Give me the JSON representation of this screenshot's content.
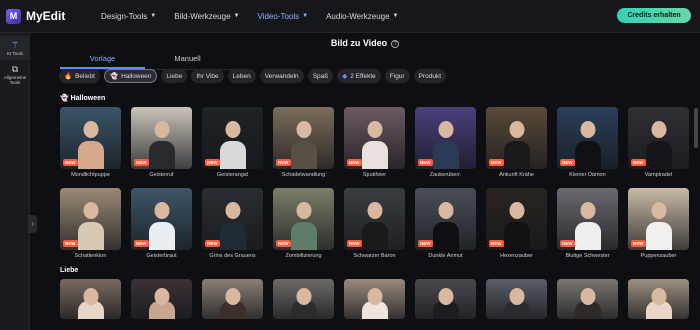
{
  "app": {
    "logo_letter": "M",
    "name": "MyEdit"
  },
  "nav": [
    {
      "label": "Design-Tools",
      "active": false
    },
    {
      "label": "Bild-Werkzeuge",
      "active": false
    },
    {
      "label": "Video-Tools",
      "active": true
    },
    {
      "label": "Audio-Werkzeuge",
      "active": false
    }
  ],
  "cta_label": "Credits erhalten",
  "sidebar": [
    {
      "label": "KI Tools",
      "icon": "magic-wand-icon",
      "active": true
    },
    {
      "label": "Allgemeine Tools",
      "icon": "layers-icon",
      "active": false
    }
  ],
  "page_title": "Bild zu Video",
  "tabs": [
    {
      "label": "Vorlage",
      "active": true
    },
    {
      "label": "Manuell",
      "active": false
    }
  ],
  "chips": [
    {
      "label": "Beliebt",
      "icon": "fire-icon",
      "active": false
    },
    {
      "label": "Halloween",
      "icon": "ghost-icon",
      "active": true
    },
    {
      "label": "Liebe",
      "active": false
    },
    {
      "label": "Ihr Vibe",
      "active": false
    },
    {
      "label": "Leben",
      "active": false
    },
    {
      "label": "Verwandeln",
      "active": false
    },
    {
      "label": "Spaß",
      "active": false
    },
    {
      "label": "2 Effekte",
      "icon": "diamond-icon",
      "active": false
    },
    {
      "label": "Figur",
      "active": false
    },
    {
      "label": "Produkt",
      "active": false
    }
  ],
  "sections": {
    "halloween": {
      "title": "Halloween",
      "icon": "ghost-icon"
    },
    "love": {
      "title": "Liebe"
    }
  },
  "new_badge": "NEW",
  "halloween_row1": [
    {
      "caption": "Mondlichtpuppe",
      "new": true,
      "bg": "#3a5668",
      "fig": "#d7a98c"
    },
    {
      "caption": "Geisterruf",
      "new": true,
      "bg": "#c9c3b9",
      "fig": "#2a2a2e"
    },
    {
      "caption": "Geisterangst",
      "new": true,
      "bg": "#1e2428",
      "fig": "#d9d9d9"
    },
    {
      "caption": "Schädelwandlung",
      "new": true,
      "bg": "#7b6d5a",
      "fig": "#5a4f45"
    },
    {
      "caption": "Spukfeier",
      "new": true,
      "bg": "#6b5a63",
      "fig": "#e8e1dd"
    },
    {
      "caption": "Zauberüberr.",
      "new": true,
      "bg": "#4b3f7d",
      "fig": "#2b3a55"
    },
    {
      "caption": "Ankunft Krähe",
      "new": true,
      "bg": "#5a4a3a",
      "fig": "#1a1a1d"
    },
    {
      "caption": "Kleiner Dämon",
      "new": true,
      "bg": "#2c3f5a",
      "fig": "#111115"
    },
    {
      "caption": "Vampiradel",
      "new": true,
      "bg": "#2f2f36",
      "fig": "#15151a"
    }
  ],
  "halloween_row2": [
    {
      "caption": "Schattenklon",
      "new": true,
      "bg": "#9a8a75",
      "fig": "#d8c9b5"
    },
    {
      "caption": "Geisterbraut",
      "new": true,
      "bg": "#3e5566",
      "fig": "#e9eef2"
    },
    {
      "caption": "Grins des Grauens",
      "new": true,
      "bg": "#2a2d33",
      "fig": "#1f2a35"
    },
    {
      "caption": "Zombifizierung",
      "new": true,
      "bg": "#7a7f68",
      "fig": "#5f7d6a"
    },
    {
      "caption": "Schwarzer Baron",
      "new": true,
      "bg": "#3a3d42",
      "fig": "#1a1a1c"
    },
    {
      "caption": "Dunkle Anmut",
      "new": true,
      "bg": "#4a4f57",
      "fig": "#0f0f12"
    },
    {
      "caption": "Hexenzauber",
      "new": true,
      "bg": "#2a2420",
      "fig": "#121212"
    },
    {
      "caption": "Blutige Schwester",
      "new": true,
      "bg": "#6a6a70",
      "fig": "#eeeeee"
    },
    {
      "caption": "Puppenzauber",
      "new": true,
      "bg": "#c9bba6",
      "fig": "#f2f0ee"
    }
  ],
  "love_row": [
    {
      "bg": "#7a6a5f",
      "fig": "#e8d5c6"
    },
    {
      "bg": "#3a3136",
      "fig": "#c7a58f"
    },
    {
      "bg": "#8a7f73",
      "fig": "#3b302a"
    },
    {
      "bg": "#6d6a66",
      "fig": "#2c2c2f"
    },
    {
      "bg": "#9a8a7d",
      "fig": "#efe4dc"
    },
    {
      "bg": "#4a4a50",
      "fig": "#1d1d20"
    },
    {
      "bg": "#5a5e66",
      "fig": "#2b2b2f"
    },
    {
      "bg": "#7a7670",
      "fig": "#2e2a28"
    },
    {
      "bg": "#9c8f80",
      "fig": "#ead6c8"
    }
  ],
  "colors": {
    "accent": "#5b8cff",
    "cta": "#34d1b6",
    "new_badge": "#ff5a3c"
  }
}
